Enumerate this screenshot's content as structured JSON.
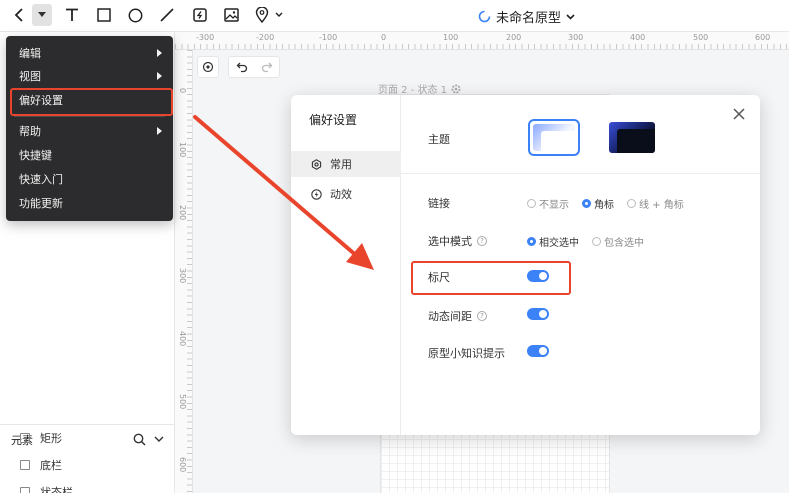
{
  "toolbar": {
    "back_icon": "chevron-left-icon",
    "menu_icon": "caret-down-icon",
    "tools": [
      "text-icon",
      "rectangle-icon",
      "circle-icon",
      "line-icon",
      "frame-icon",
      "image-icon",
      "pin-icon"
    ],
    "doc_title": "未命名原型"
  },
  "rulers": {
    "horizontal": [
      "-300",
      "-200",
      "-100",
      "0",
      "100",
      "200",
      "300",
      "400",
      "500",
      "600"
    ],
    "vertical": [
      "0",
      "100",
      "200",
      "300",
      "400",
      "500",
      "600"
    ]
  },
  "canvas": {
    "page_state": "页面 2 - 状态 1"
  },
  "main_menu": {
    "items": [
      {
        "label": "编辑",
        "has_submenu": true
      },
      {
        "label": "视图",
        "has_submenu": true
      },
      {
        "label": "偏好设置",
        "has_submenu": false
      },
      {
        "label": "帮助",
        "has_submenu": true
      },
      {
        "label": "快捷键",
        "has_submenu": false
      },
      {
        "label": "快速入门",
        "has_submenu": false
      },
      {
        "label": "功能更新",
        "has_submenu": false
      }
    ]
  },
  "elements_panel": {
    "title": "元素",
    "items": [
      "矩形",
      "底栏",
      "状态栏"
    ]
  },
  "preferences": {
    "title": "偏好设置",
    "nav": [
      "常用",
      "动效"
    ],
    "theme_label": "主题",
    "link_label": "链接",
    "link_options": [
      "不显示",
      "角标",
      "线 + 角标"
    ],
    "link_selected": "角标",
    "select_mode_label": "选中模式",
    "select_mode_options": [
      "相交选中",
      "包含选中"
    ],
    "select_mode_selected": "相交选中",
    "ruler_label": "标尺",
    "ruler_on": true,
    "dynamic_spacing_label": "动态间距",
    "dynamic_spacing_on": true,
    "tips_label": "原型小知识提示",
    "tips_on": true
  },
  "colors": {
    "accent": "#3b82f6",
    "annotation": "#e8452c",
    "menu_bg": "#2c2c2e"
  }
}
